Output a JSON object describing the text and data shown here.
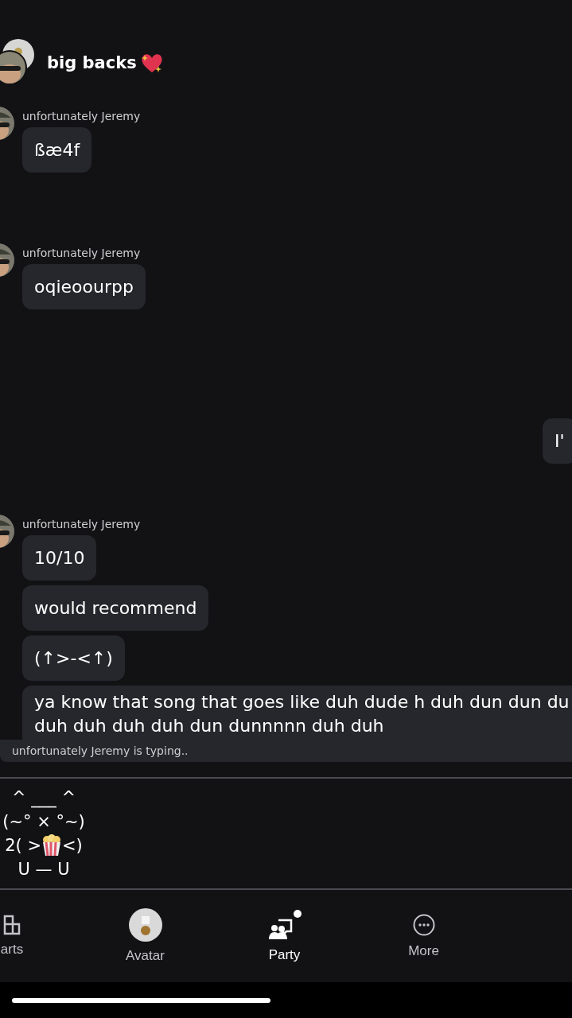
{
  "header": {
    "title": "big backs"
  },
  "messages": [
    {
      "kind": "incoming",
      "sender": "unfortunately Jeremy",
      "bubbles": [
        {
          "lines": [
            "ßæ4f"
          ]
        }
      ]
    },
    {
      "kind": "incoming",
      "sender": "unfortunately Jeremy",
      "bubbles": [
        {
          "lines": [
            "oqieoourpp"
          ]
        }
      ]
    },
    {
      "kind": "outgoing",
      "bubbles": [
        {
          "lines": [
            "I'"
          ]
        }
      ]
    },
    {
      "kind": "incoming",
      "sender": "unfortunately Jeremy",
      "bubbles": [
        {
          "lines": [
            "10/10"
          ]
        },
        {
          "lines": [
            "would recommend"
          ]
        },
        {
          "lines": [
            "(↑>-<↑)"
          ]
        },
        {
          "lines": [
            "ya know that song that goes like duh dude h duh dun dun du",
            "duh duh duh duh dun dunnnnn duh duh"
          ]
        }
      ]
    }
  ],
  "typing_indicator": "unfortunately Jeremy is typing..",
  "composer": {
    "value": [
      {
        "kind": "text",
        "text": "^ ___ ^"
      },
      {
        "kind": "text",
        "text": "(~° × °~)"
      },
      {
        "kind": "popcorn",
        "before": "2( >",
        "after": "<)"
      },
      {
        "kind": "text",
        "text": "U — U"
      }
    ]
  },
  "nav": [
    {
      "kind": "parts",
      "label": "arts",
      "selected": false
    },
    {
      "kind": "avatar",
      "label": "Avatar",
      "selected": false
    },
    {
      "kind": "party",
      "label": "Party",
      "selected": true
    },
    {
      "kind": "more",
      "label": "More",
      "selected": false
    }
  ]
}
